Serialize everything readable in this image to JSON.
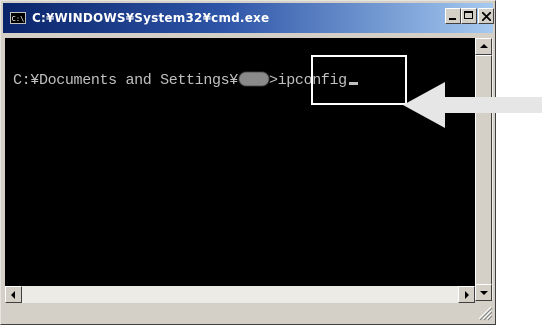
{
  "window": {
    "title": "C:¥WINDOWS¥System32¥cmd.exe",
    "icon_text": "C:\\",
    "icon": "console-window-icon"
  },
  "caption_buttons": {
    "minimize": "minimize-icon",
    "maximize": "maximize-icon",
    "close": "close-icon"
  },
  "console": {
    "prompt_prefix": "C:¥Documents and Settings¥",
    "prompt_suffix": ">",
    "command": "ipconfig",
    "text_color": "#c0c0c0",
    "background": "#000000"
  },
  "annotation": {
    "box_color": "#ffffff",
    "arrow_color": "#e6e6e6",
    "arrow_icon": "left-arrow-icon"
  },
  "colors": {
    "titlebar_start": "#0a246a",
    "titlebar_end": "#a6caf0",
    "chrome": "#d4d0c8"
  }
}
